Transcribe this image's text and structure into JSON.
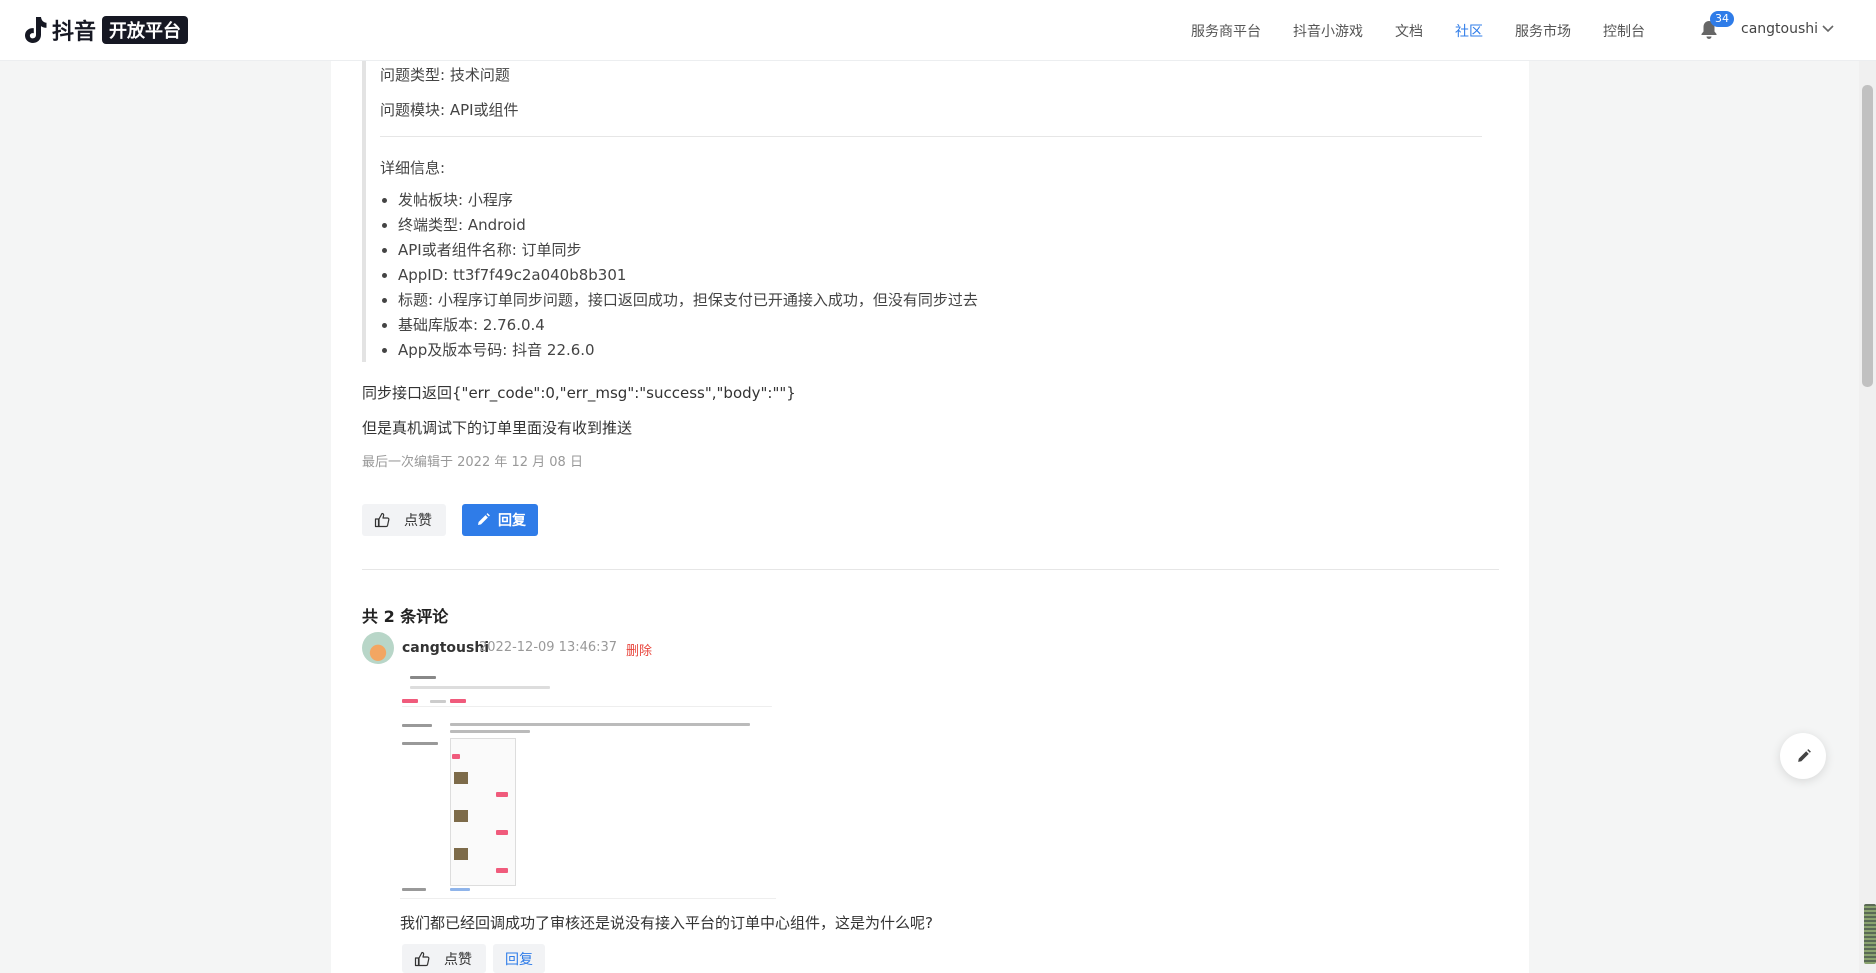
{
  "header": {
    "logo_text": "抖音",
    "logo_badge": "开放平台",
    "nav": [
      {
        "label": "服务商平台"
      },
      {
        "label": "抖音小游戏"
      },
      {
        "label": "文档"
      },
      {
        "label": "社区",
        "active": true
      },
      {
        "label": "服务市场"
      },
      {
        "label": "控制台"
      }
    ],
    "notification_count": "34",
    "username": "cangtoushi",
    "accent_color": "#2f7ce8"
  },
  "post": {
    "meta": {
      "question_type": "问题类型: 技术问题",
      "question_module": "问题模块: API或组件"
    },
    "details_title": "详细信息:",
    "details": [
      "发帖板块: 小程序",
      "终端类型: Android",
      "API或者组件名称: 订单同步",
      "AppID: tt3f7f49c2a040b8b301",
      "标题: 小程序订单同步问题，接口返回成功，担保支付已开通接入成功，但没有同步过去",
      "基础库版本: 2.76.0.4",
      "App及版本号码: 抖音 22.6.0"
    ],
    "body": [
      "同步接口返回{\"err_code\":0,\"err_msg\":\"success\",\"body\":\"\"}",
      "但是真机调试下的订单里面没有收到推送"
    ],
    "edited": "最后一次编辑于 2022 年 12 月 08 日",
    "like_label": "点赞",
    "reply_label": "回复"
  },
  "comments": {
    "title": "共 2 条评论",
    "items": [
      {
        "user": "cangtoushi",
        "time": "2022-12-09 13:46:37",
        "delete_label": "删除",
        "text": "我们都已经回调成功了审核还是说没有接入平台的订单中心组件，这是为什么呢?",
        "like_label": "点赞",
        "reply_label": "回复"
      }
    ]
  }
}
